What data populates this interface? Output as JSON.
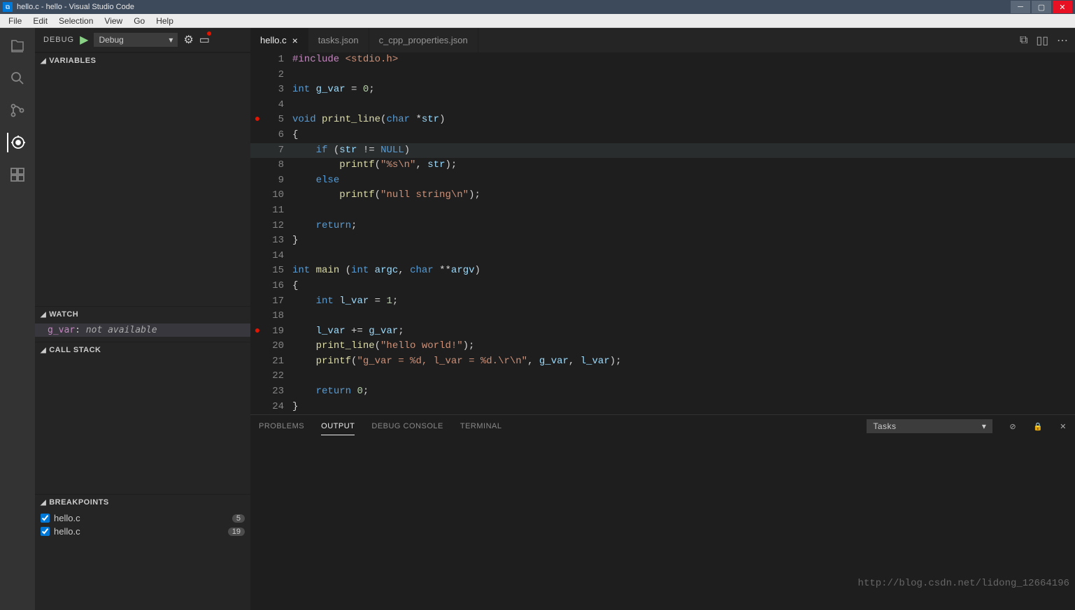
{
  "titlebar": {
    "title": "hello.c - hello - Visual Studio Code"
  },
  "menu": {
    "items": [
      "File",
      "Edit",
      "Selection",
      "View",
      "Go",
      "Help"
    ]
  },
  "sidebar": {
    "debug_label": "DEBUG",
    "config": "Debug",
    "sections": {
      "variables": "VARIABLES",
      "watch": "WATCH",
      "callstack": "CALL STACK",
      "breakpoints": "BREAKPOINTS"
    },
    "watch_items": [
      {
        "name": "g_var",
        "sep": ":",
        "status": "not available"
      }
    ],
    "breakpoints": [
      {
        "file": "hello.c",
        "line": "5",
        "checked": true
      },
      {
        "file": "hello.c",
        "line": "19",
        "checked": true
      }
    ]
  },
  "tabs": [
    {
      "label": "hello.c",
      "active": true
    },
    {
      "label": "tasks.json",
      "active": false
    },
    {
      "label": "c_cpp_properties.json",
      "active": false
    }
  ],
  "code": {
    "lines": [
      {
        "n": 1,
        "bp": false,
        "hl": false,
        "tokens": [
          [
            "include",
            "#include"
          ],
          [
            "punct",
            " "
          ],
          [
            "string",
            "<stdio.h>"
          ]
        ]
      },
      {
        "n": 2,
        "bp": false,
        "hl": false,
        "tokens": []
      },
      {
        "n": 3,
        "bp": false,
        "hl": false,
        "tokens": [
          [
            "type",
            "int"
          ],
          [
            "punct",
            " "
          ],
          [
            "var",
            "g_var"
          ],
          [
            "punct",
            " = "
          ],
          [
            "number",
            "0"
          ],
          [
            "punct",
            ";"
          ]
        ]
      },
      {
        "n": 4,
        "bp": false,
        "hl": false,
        "tokens": []
      },
      {
        "n": 5,
        "bp": true,
        "hl": false,
        "tokens": [
          [
            "keyword",
            "void"
          ],
          [
            "punct",
            " "
          ],
          [
            "func",
            "print_line"
          ],
          [
            "punct",
            "("
          ],
          [
            "type",
            "char"
          ],
          [
            "punct",
            " *"
          ],
          [
            "var",
            "str"
          ],
          [
            "punct",
            ")"
          ]
        ]
      },
      {
        "n": 6,
        "bp": false,
        "hl": false,
        "tokens": [
          [
            "punct",
            "{"
          ]
        ]
      },
      {
        "n": 7,
        "bp": false,
        "hl": true,
        "tokens": [
          [
            "punct",
            "    "
          ],
          [
            "keyword",
            "if"
          ],
          [
            "punct",
            " ("
          ],
          [
            "var",
            "str"
          ],
          [
            "punct",
            " != "
          ],
          [
            "const",
            "NULL"
          ],
          [
            "punct",
            ")"
          ]
        ]
      },
      {
        "n": 8,
        "bp": false,
        "hl": false,
        "tokens": [
          [
            "punct",
            "        "
          ],
          [
            "func",
            "printf"
          ],
          [
            "punct",
            "("
          ],
          [
            "string",
            "\"%s\\n\""
          ],
          [
            "punct",
            ", "
          ],
          [
            "var",
            "str"
          ],
          [
            "punct",
            ");"
          ]
        ]
      },
      {
        "n": 9,
        "bp": false,
        "hl": false,
        "tokens": [
          [
            "punct",
            "    "
          ],
          [
            "keyword",
            "else"
          ]
        ]
      },
      {
        "n": 10,
        "bp": false,
        "hl": false,
        "tokens": [
          [
            "punct",
            "        "
          ],
          [
            "func",
            "printf"
          ],
          [
            "punct",
            "("
          ],
          [
            "string",
            "\"null string\\n\""
          ],
          [
            "punct",
            ");"
          ]
        ]
      },
      {
        "n": 11,
        "bp": false,
        "hl": false,
        "tokens": []
      },
      {
        "n": 12,
        "bp": false,
        "hl": false,
        "tokens": [
          [
            "punct",
            "    "
          ],
          [
            "keyword",
            "return"
          ],
          [
            "punct",
            ";"
          ]
        ]
      },
      {
        "n": 13,
        "bp": false,
        "hl": false,
        "tokens": [
          [
            "punct",
            "}"
          ]
        ]
      },
      {
        "n": 14,
        "bp": false,
        "hl": false,
        "tokens": []
      },
      {
        "n": 15,
        "bp": false,
        "hl": false,
        "tokens": [
          [
            "type",
            "int"
          ],
          [
            "punct",
            " "
          ],
          [
            "func",
            "main"
          ],
          [
            "punct",
            " ("
          ],
          [
            "type",
            "int"
          ],
          [
            "punct",
            " "
          ],
          [
            "var",
            "argc"
          ],
          [
            "punct",
            ", "
          ],
          [
            "type",
            "char"
          ],
          [
            "punct",
            " **"
          ],
          [
            "var",
            "argv"
          ],
          [
            "punct",
            ")"
          ]
        ]
      },
      {
        "n": 16,
        "bp": false,
        "hl": false,
        "tokens": [
          [
            "punct",
            "{"
          ]
        ]
      },
      {
        "n": 17,
        "bp": false,
        "hl": false,
        "tokens": [
          [
            "punct",
            "    "
          ],
          [
            "type",
            "int"
          ],
          [
            "punct",
            " "
          ],
          [
            "var",
            "l_var"
          ],
          [
            "punct",
            " = "
          ],
          [
            "number",
            "1"
          ],
          [
            "punct",
            ";"
          ]
        ]
      },
      {
        "n": 18,
        "bp": false,
        "hl": false,
        "tokens": []
      },
      {
        "n": 19,
        "bp": true,
        "hl": false,
        "tokens": [
          [
            "punct",
            "    "
          ],
          [
            "var",
            "l_var"
          ],
          [
            "punct",
            " += "
          ],
          [
            "var",
            "g_var"
          ],
          [
            "punct",
            ";"
          ]
        ]
      },
      {
        "n": 20,
        "bp": false,
        "hl": false,
        "tokens": [
          [
            "punct",
            "    "
          ],
          [
            "func",
            "print_line"
          ],
          [
            "punct",
            "("
          ],
          [
            "string",
            "\"hello world!\""
          ],
          [
            "punct",
            ");"
          ]
        ]
      },
      {
        "n": 21,
        "bp": false,
        "hl": false,
        "tokens": [
          [
            "punct",
            "    "
          ],
          [
            "func",
            "printf"
          ],
          [
            "punct",
            "("
          ],
          [
            "string",
            "\"g_var = %d, l_var = %d.\\r\\n\""
          ],
          [
            "punct",
            ", "
          ],
          [
            "var",
            "g_var"
          ],
          [
            "punct",
            ", "
          ],
          [
            "var",
            "l_var"
          ],
          [
            "punct",
            ");"
          ]
        ]
      },
      {
        "n": 22,
        "bp": false,
        "hl": false,
        "tokens": []
      },
      {
        "n": 23,
        "bp": false,
        "hl": false,
        "tokens": [
          [
            "punct",
            "    "
          ],
          [
            "keyword",
            "return"
          ],
          [
            "punct",
            " "
          ],
          [
            "number",
            "0"
          ],
          [
            "punct",
            ";"
          ]
        ]
      },
      {
        "n": 24,
        "bp": false,
        "hl": false,
        "tokens": [
          [
            "punct",
            "}"
          ]
        ]
      }
    ]
  },
  "bottom": {
    "tabs": [
      "PROBLEMS",
      "OUTPUT",
      "DEBUG CONSOLE",
      "TERMINAL"
    ],
    "active_tab": "OUTPUT",
    "tasks_label": "Tasks"
  },
  "watermark": "http://blog.csdn.net/lidong_12664196"
}
